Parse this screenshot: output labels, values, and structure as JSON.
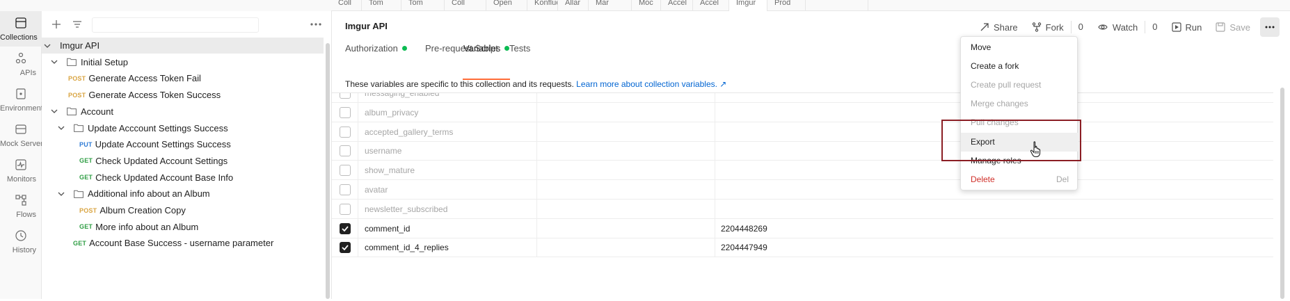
{
  "top_tabs": [
    "Coll",
    "Tom",
    "Tom",
    "Coll",
    "Open",
    "Konfluen",
    "Allar",
    "Mar",
    "Moc",
    "Accel",
    "Accel",
    "Imgur",
    "Prod",
    ""
  ],
  "rail": [
    {
      "label": "Collections",
      "icon": "collections-icon",
      "active": true
    },
    {
      "label": "APIs",
      "icon": "apis-icon"
    },
    {
      "label": "Environments",
      "icon": "environments-icon"
    },
    {
      "label": "Mock Servers",
      "icon": "mock-servers-icon"
    },
    {
      "label": "Monitors",
      "icon": "monitors-icon"
    },
    {
      "label": "Flows",
      "icon": "flows-icon"
    },
    {
      "label": "History",
      "icon": "history-icon"
    }
  ],
  "sidebar": {
    "tree": [
      {
        "label": "Imgur API",
        "level": 0,
        "type": "collection",
        "selected": true
      },
      {
        "label": "Initial Setup",
        "level": 1,
        "type": "folder"
      },
      {
        "label": "Generate Access Token Fail",
        "level": 2,
        "type": "request",
        "method": "POST"
      },
      {
        "label": "Generate Access Token Success",
        "level": 2,
        "type": "request",
        "method": "POST"
      },
      {
        "label": "Account",
        "level": 1,
        "type": "folder"
      },
      {
        "label": "Update Acccount Settings Success",
        "level": 2,
        "type": "folder"
      },
      {
        "label": "Update Account Settings Success",
        "level": 3,
        "type": "request",
        "method": "PUT"
      },
      {
        "label": "Check Updated Account Settings",
        "level": 3,
        "type": "request",
        "method": "GET"
      },
      {
        "label": "Check Updated Account Base Info",
        "level": 3,
        "type": "request",
        "method": "GET"
      },
      {
        "label": "Additional info about an Album",
        "level": 2,
        "type": "folder"
      },
      {
        "label": "Album Creation Copy",
        "level": 3,
        "type": "request",
        "method": "POST"
      },
      {
        "label": "More info about an Album",
        "level": 3,
        "type": "request",
        "method": "GET"
      },
      {
        "label": "Account Base Success - username parameter",
        "level": 2,
        "type": "request",
        "method": "GET"
      }
    ]
  },
  "header": {
    "title": "Imgur API",
    "share": "Share",
    "fork": "Fork",
    "fork_count": "0",
    "watch": "Watch",
    "watch_count": "0",
    "run": "Run",
    "save": "Save"
  },
  "tabs": [
    {
      "label": "Authorization",
      "dot": true
    },
    {
      "label": "Pre-request Script",
      "dot": false
    },
    {
      "label": "Tests",
      "dot": false
    },
    {
      "label": "Variables",
      "dot": true,
      "active": true
    }
  ],
  "info": {
    "text": "These variables are specific to this collection and its requests.",
    "link": "Learn more about collection variables. ↗"
  },
  "variables": [
    {
      "name": "messaging_enabled",
      "value": "",
      "checked": false
    },
    {
      "name": "album_privacy",
      "value": "",
      "checked": false
    },
    {
      "name": "accepted_gallery_terms",
      "value": "",
      "checked": false
    },
    {
      "name": "username",
      "value": "",
      "checked": false
    },
    {
      "name": "show_mature",
      "value": "",
      "checked": false
    },
    {
      "name": "avatar",
      "value": "",
      "checked": false
    },
    {
      "name": "newsletter_subscribed",
      "value": "",
      "checked": false
    },
    {
      "name": "comment_id",
      "value": "2204448269",
      "checked": true
    },
    {
      "name": "comment_id_4_replies",
      "value": "2204447949",
      "checked": true
    }
  ],
  "menu": [
    {
      "label": "Move"
    },
    {
      "label": "Create a fork"
    },
    {
      "label": "Create pull request",
      "disabled": true
    },
    {
      "label": "Merge changes",
      "disabled": true
    },
    {
      "label": "Pull changes",
      "disabled": true
    },
    {
      "label": "Export",
      "hover": true
    },
    {
      "label": "Manage roles"
    },
    {
      "label": "Delete",
      "danger": true,
      "shortcut": "Del"
    }
  ],
  "colors": {
    "accent": "#ff6c37",
    "get": "#2f9e44",
    "post": "#d9a441",
    "put": "#2f7bd5",
    "delete": "#d0302a",
    "dot": "#0cbb52",
    "highlight": "#8b1e24"
  }
}
